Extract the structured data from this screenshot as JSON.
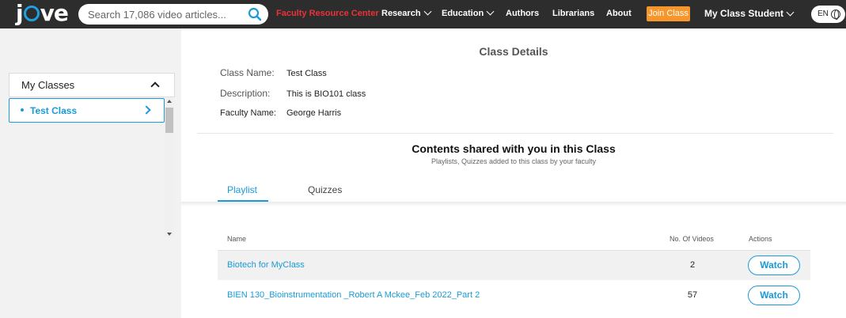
{
  "header": {
    "logo_text": "jove",
    "search_placeholder": "Search 17,086 video articles...",
    "nav": {
      "faculty": "Faculty Resource Center",
      "research": "Research",
      "education": "Education",
      "authors": "Authors",
      "librarians": "Librarians",
      "about": "About",
      "join": "Join Class",
      "student": "My Class Student",
      "lang": "EN"
    }
  },
  "sidebar": {
    "heading": "My Classes",
    "items": [
      {
        "label": "Test Class"
      }
    ]
  },
  "details": {
    "title": "Class Details",
    "class_name_label": "Class Name:",
    "class_name": "Test Class",
    "description_label": "Description:",
    "description": "This is BIO101 class",
    "faculty_label": "Faculty Name:",
    "faculty": "George Harris"
  },
  "shared": {
    "title": "Contents shared with you in this Class",
    "subtitle": "Playlists, Quizzes added to this class by your faculty"
  },
  "tabs": {
    "playlist": "Playlist",
    "quizzes": "Quizzes"
  },
  "table": {
    "headers": {
      "name": "Name",
      "count": "No. Of Videos",
      "actions": "Actions"
    },
    "rows": [
      {
        "name": "Biotech for MyClass",
        "count": "2",
        "action": "Watch"
      },
      {
        "name": "BIEN 130_Bioinstrumentation _Robert A Mckee_Feb 2022_Part 2",
        "count": "57",
        "action": "Watch"
      }
    ]
  },
  "colors": {
    "accent": "#1a9bd7",
    "nav_bg": "#2d2d2d",
    "faculty_red": "#e8333a",
    "join_orange": "#f7962a"
  }
}
